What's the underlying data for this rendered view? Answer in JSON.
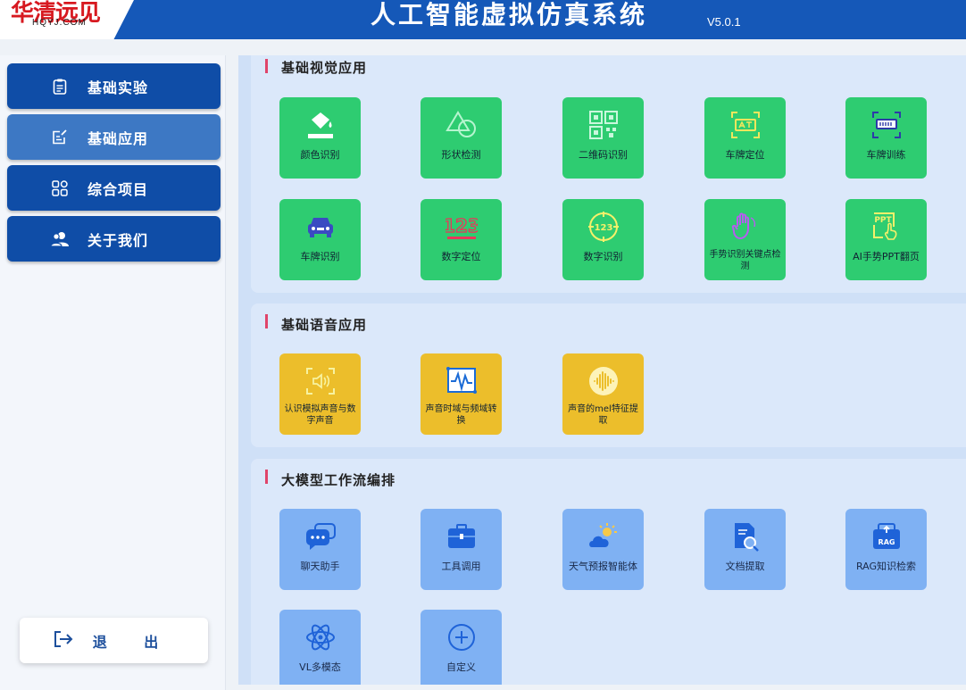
{
  "header": {
    "logo_main": "华清远见",
    "logo_sub": "HQYJ.COM",
    "title": "人工智能虚拟仿真系统",
    "version": "V5.0.1"
  },
  "sidebar": {
    "items": [
      {
        "label": "基础实验",
        "icon": "document-icon",
        "active": false
      },
      {
        "label": "基础应用",
        "icon": "edit-note-icon",
        "active": true
      },
      {
        "label": "综合项目",
        "icon": "grid-apps-icon",
        "active": false
      },
      {
        "label": "关于我们",
        "icon": "users-icon",
        "active": false
      }
    ],
    "logout_label": "退 出"
  },
  "sections": [
    {
      "title": "基础视觉应用",
      "tiles": [
        {
          "label": "颜色识别",
          "icon": "paint-bucket-icon"
        },
        {
          "label": "形状检测",
          "icon": "shapes-icon"
        },
        {
          "label": "二维码识别",
          "icon": "qr-code-icon"
        },
        {
          "label": "车牌定位",
          "icon": "plate-scan-icon"
        },
        {
          "label": "车牌训练",
          "icon": "plate-train-icon"
        },
        {
          "label": "车牌识别",
          "icon": "car-icon"
        },
        {
          "label": "数字定位",
          "icon": "number-123-icon"
        },
        {
          "label": "数字识别",
          "icon": "number-target-icon"
        },
        {
          "label": "手势识别关键点检测",
          "icon": "hand-gesture-icon"
        },
        {
          "label": "AI手势PPT翻页",
          "icon": "ppt-gesture-icon"
        }
      ]
    },
    {
      "title": "基础语音应用",
      "tiles": [
        {
          "label": "认识模拟声音与数字声音",
          "icon": "sound-scan-icon"
        },
        {
          "label": "声音时域与频域转换",
          "icon": "waveform-icon"
        },
        {
          "label": "声音的mel特征提取",
          "icon": "audio-circle-icon"
        }
      ]
    },
    {
      "title": "大模型工作流编排",
      "tiles": [
        {
          "label": "聊天助手",
          "icon": "chat-icon"
        },
        {
          "label": "工具调用",
          "icon": "toolbox-icon"
        },
        {
          "label": "天气预报智能体",
          "icon": "weather-icon"
        },
        {
          "label": "文档提取",
          "icon": "document-search-icon"
        },
        {
          "label": "RAG知识检索",
          "icon": "rag-icon"
        },
        {
          "label": "VL多模态",
          "icon": "atom-icon"
        },
        {
          "label": "自定义",
          "icon": "plus-circle-icon"
        }
      ]
    }
  ],
  "colors": {
    "header": "#1558b8",
    "nav": "#0f4da7",
    "nav_active": "#3d78c4",
    "vision_tile": "#2ecc71",
    "audio_tile": "#ecbe2b",
    "llm_tile": "#7fb1f3",
    "section_marker": "#e0446a"
  }
}
